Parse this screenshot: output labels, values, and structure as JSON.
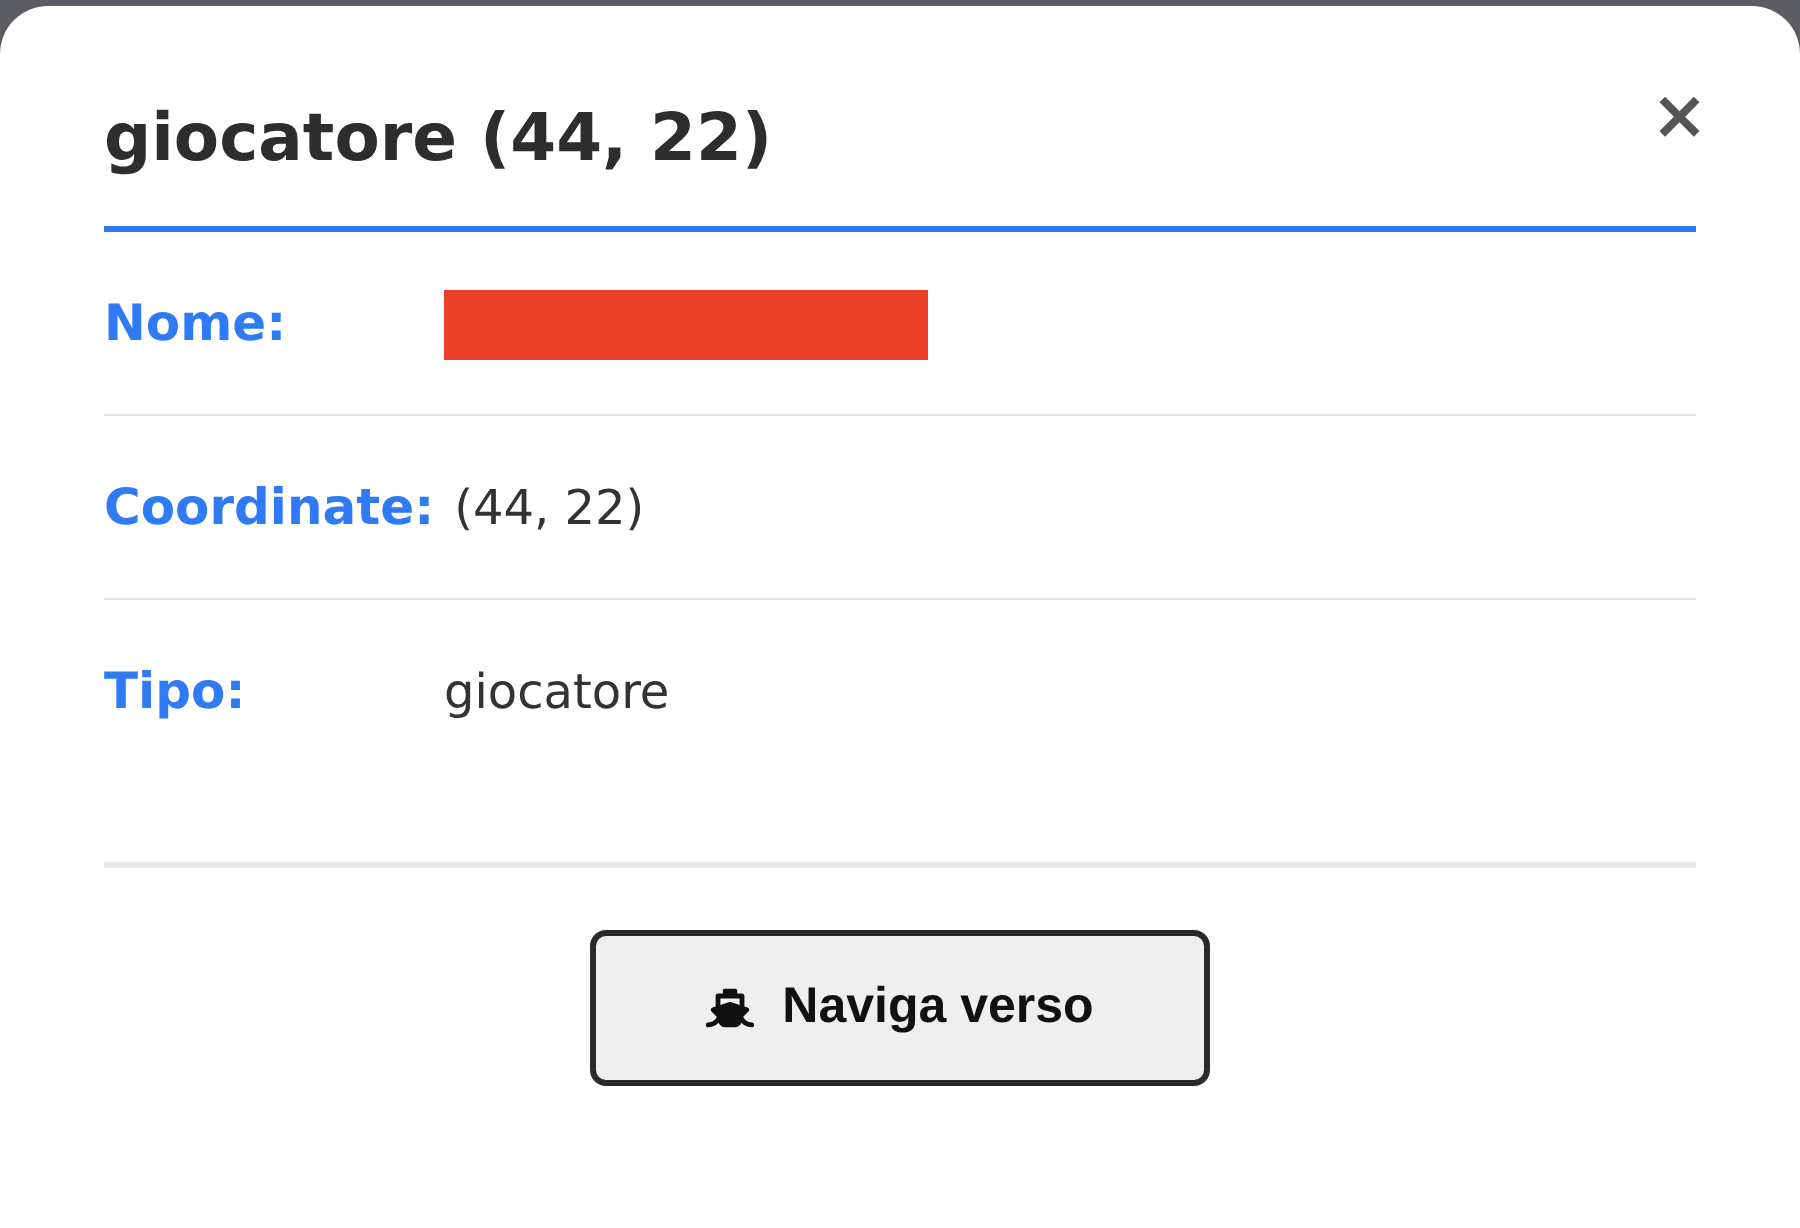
{
  "dialog": {
    "title": "giocatore (44, 22)",
    "close": "×"
  },
  "fields": [
    {
      "kind": "redacted",
      "label": "Nome:"
    },
    {
      "kind": "text",
      "label": "Coordinate:",
      "value": "(44, 22)"
    },
    {
      "kind": "text",
      "label": "Tipo:",
      "value": "giocatore"
    }
  ],
  "button": {
    "label": "Naviga verso"
  }
}
